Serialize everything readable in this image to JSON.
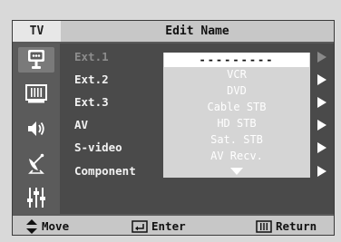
{
  "header": {
    "tv_label": "TV",
    "title": "Edit Name"
  },
  "sidebar": {
    "icons": [
      "input-icon",
      "picture-icon",
      "sound-icon",
      "channel-icon",
      "setup-icon"
    ]
  },
  "rows": [
    {
      "label": "Ext.1",
      "dim": true
    },
    {
      "label": "Ext.2",
      "dim": false
    },
    {
      "label": "Ext.3",
      "dim": false
    },
    {
      "label": "AV",
      "dim": false
    },
    {
      "label": "S-video",
      "dim": false
    },
    {
      "label": "Component",
      "dim": false
    }
  ],
  "dropdown": {
    "selected": "---------",
    "options": [
      "VCR",
      "DVD",
      "Cable STB",
      "HD STB",
      "Sat. STB",
      "AV Recv."
    ]
  },
  "footer": {
    "move": "Move",
    "enter": "Enter",
    "return": "Return"
  },
  "colors": {
    "header_bg": "#c7c7c7",
    "panel_bg": "#4a4a4a",
    "dropdown_bg": "#d5d5d5",
    "text": "#f2f2f2"
  }
}
